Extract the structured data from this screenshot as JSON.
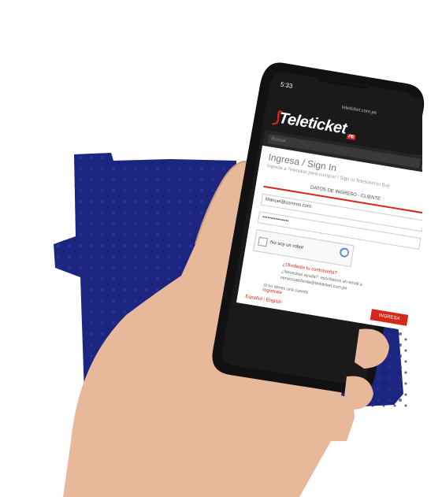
{
  "colors": {
    "background_folder": "#1c2680",
    "brand_red": "#d5281b",
    "phone_frame": "#111111",
    "skin": "#e8b89b"
  },
  "phone": {
    "time": "5:33",
    "url": "teleticket.com.pe",
    "brand": "Teleticket",
    "brand_suffix": "PE",
    "search_placeholder": "Buscar",
    "menu_icon": "hamburger-icon",
    "search_icon": "magnifier-icon"
  },
  "login": {
    "title": "Ingresa / Sign In",
    "subtitle": "Ingresa a Teleticket para comprar / Sign In Teleticket to Buy",
    "tab_label": "DATOS DE INGRESO - CLIENTE",
    "email_value": "Manuel@correos.com",
    "password_value": "••••••••••••••••",
    "captcha_label": "No soy un robot",
    "forgot_link": "¿Olvidaste tu contraseña?",
    "help_text": "¿Necesitas ayuda?, escríbenos un email a servicioalcliente@teleticket.com.pe",
    "no_account_text": "Si no tienes una cuenta",
    "register_link": "regístrate",
    "lang_es": "Español",
    "lang_sep": "|",
    "lang_en": "English",
    "submit_label": "INGRESA"
  }
}
